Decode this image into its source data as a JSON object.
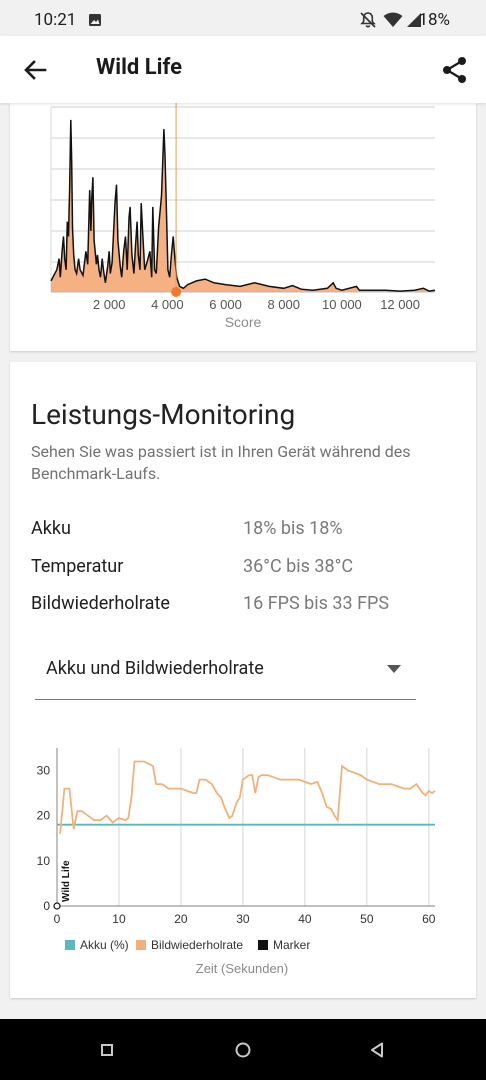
{
  "status_bar": {
    "time": "10:21",
    "battery_pct": "18%"
  },
  "app_bar": {
    "title": "Wild Life",
    "back_icon": "arrow-left-icon",
    "share_icon": "share-icon"
  },
  "histogram": {
    "x_ticks": [
      "2 000",
      "4 000",
      "6 000",
      "8 000",
      "10 000",
      "12 000"
    ],
    "x_label": "Score"
  },
  "performance": {
    "title": "Leistungs-Monitoring",
    "description": "Sehen Sie was passiert ist in Ihren Gerät während des Benchmark-Laufs.",
    "rows": [
      {
        "label": "Akku",
        "value": "18% bis 18%"
      },
      {
        "label": "Temperatur",
        "value": "36°C bis 38°C"
      },
      {
        "label": "Bildwiederholrate",
        "value": "16 FPS bis 33 FPS"
      }
    ],
    "dropdown_selected": "Akku und Bildwiederholrate"
  },
  "chart_data": [
    {
      "type": "area",
      "x": [
        0,
        400,
        600,
        800,
        1000,
        1200,
        1400,
        1500,
        1600,
        1800,
        2000,
        2200,
        2400,
        2600,
        2800,
        3000,
        3200,
        3400,
        3500,
        3600,
        3700,
        3800,
        4000,
        4200,
        4400,
        4600,
        5000,
        5500,
        6000,
        6500,
        7000,
        7500,
        8000,
        8500,
        9000,
        9500,
        10000,
        10500,
        11000,
        11500,
        12000,
        12500,
        13000,
        13200
      ],
      "x_ticks": [
        "2 000",
        "4 000",
        "6 000",
        "8 000",
        "10 000",
        "12 000"
      ],
      "xlabel": "Score",
      "marker_x": 4300,
      "grid": true
    },
    {
      "type": "line",
      "xlabel": "Zeit (Sekunden)",
      "xlim": [
        0,
        61
      ],
      "ylim": [
        0,
        35
      ],
      "x_ticks": [
        0,
        10,
        20,
        30,
        40,
        50,
        60
      ],
      "y_ticks": [
        0,
        10,
        20,
        30
      ],
      "series": [
        {
          "name": "Akku (%)",
          "color": "#5bb8c1",
          "x": [
            0,
            61
          ],
          "y": [
            18,
            18
          ]
        },
        {
          "name": "Bildwiederholrate",
          "color": "#f0b27a",
          "x": [
            0.5,
            1.2,
            2,
            2.7,
            3.3,
            4,
            5,
            6,
            7,
            8,
            9,
            10,
            11,
            11.5,
            12,
            12.5,
            14,
            15.5,
            16,
            17,
            18,
            19,
            20,
            21,
            22,
            22.5,
            23,
            24,
            25,
            25.8,
            26.5,
            27,
            27.8,
            28.3,
            29,
            29.5,
            30,
            31,
            31.5,
            32,
            32.5,
            33,
            34,
            35,
            36,
            37,
            38,
            39,
            40,
            41,
            42,
            42.8,
            43.5,
            44.2,
            44.8,
            45.3,
            46,
            47,
            48,
            49,
            50,
            51,
            52,
            53,
            54,
            55,
            56,
            57,
            58,
            59,
            59.5,
            60,
            60.5,
            61
          ],
          "y": [
            16,
            26,
            26,
            17,
            21,
            21,
            20,
            19,
            19,
            20,
            18.5,
            19.5,
            19,
            19.5,
            24,
            32,
            32,
            31,
            27,
            27,
            26,
            26,
            26,
            25.5,
            25,
            25,
            28,
            28,
            27,
            25,
            24,
            22,
            19.5,
            20,
            23,
            24,
            28,
            29,
            29,
            25,
            28.5,
            29,
            29,
            28.5,
            28,
            28,
            28,
            28,
            27.5,
            27,
            27.5,
            25,
            22,
            21.5,
            20,
            19,
            31,
            30,
            29.5,
            29,
            28,
            27.5,
            27,
            27,
            27,
            26.5,
            26,
            26,
            27,
            25,
            24.5,
            25.5,
            25,
            25.5
          ]
        },
        {
          "name": "Marker",
          "color": "#111111",
          "x": [
            0
          ],
          "y": [
            0
          ]
        }
      ],
      "annotations": [
        "Wild Life"
      ],
      "legend": [
        "Akku (%)",
        "Bildwiederholrate",
        "Marker"
      ]
    }
  ]
}
